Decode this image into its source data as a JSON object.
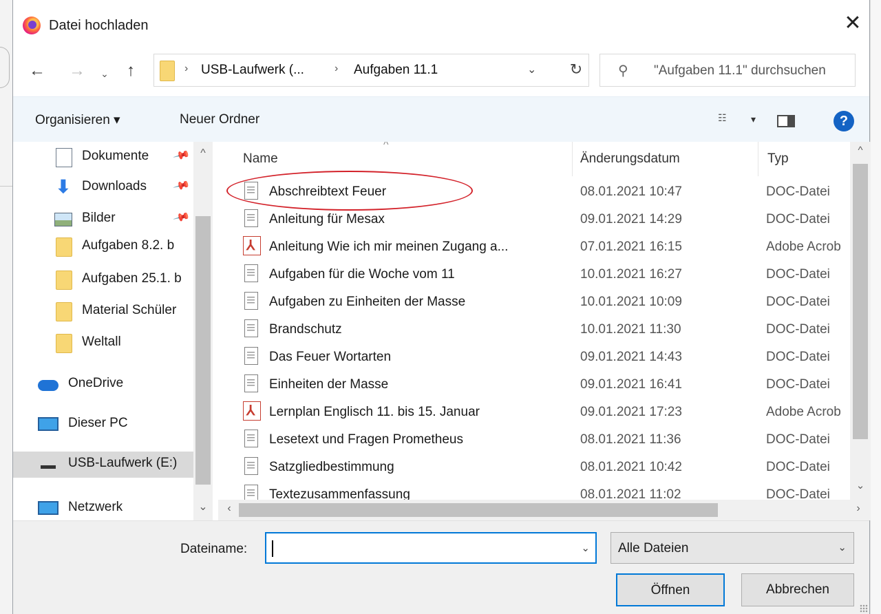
{
  "window": {
    "title": "Datei hochladen",
    "close_icon": "close-icon"
  },
  "nav": {
    "back": "←",
    "forward": "→",
    "recent": "⌄",
    "up": "↑",
    "breadcrumbs": [
      "USB-Laufwerk (...",
      "Aufgaben 11.1"
    ],
    "crumb_sep": "›",
    "dropdown": "⌄",
    "refresh": "↻",
    "search_placeholder": "\"Aufgaben 11.1\" durchsuchen"
  },
  "commandbar": {
    "organize": "Organisieren ▾",
    "new_folder": "Neuer Ordner",
    "view_drop": "▾",
    "help": "?"
  },
  "sidebar": {
    "items": [
      {
        "label": "Dokumente",
        "icon": "documents-icon",
        "pinned": true
      },
      {
        "label": "Downloads",
        "icon": "download-arrow-icon",
        "pinned": true
      },
      {
        "label": "Bilder",
        "icon": "pictures-icon",
        "pinned": true
      },
      {
        "label": "Aufgaben  8.2. b",
        "icon": "folder-icon"
      },
      {
        "label": "Aufgaben 25.1. b",
        "icon": "folder-icon"
      },
      {
        "label": "Material Schüler",
        "icon": "folder-icon"
      },
      {
        "label": "Weltall",
        "icon": "folder-icon"
      },
      {
        "label": "OneDrive",
        "icon": "cloud-icon"
      },
      {
        "label": "Dieser PC",
        "icon": "monitor-icon"
      },
      {
        "label": "USB-Laufwerk (E:)",
        "icon": "usb-drive-icon",
        "selected": true
      },
      {
        "label": "Netzwerk",
        "icon": "network-icon"
      }
    ],
    "pin_glyph": "📌"
  },
  "filelist": {
    "columns": {
      "name": "Name",
      "date": "Änderungsdatum",
      "type": "Typ"
    },
    "sort_caret": "^",
    "rows": [
      {
        "name": "Abschreibtext Feuer",
        "date": "08.01.2021 10:47",
        "type": "DOC-Datei",
        "kind": "doc"
      },
      {
        "name": "Anleitung für Mesax",
        "date": "09.01.2021 14:29",
        "type": "DOC-Datei",
        "kind": "doc"
      },
      {
        "name": "Anleitung Wie ich mir meinen Zugang a...",
        "date": "07.01.2021 16:15",
        "type": "Adobe Acrob",
        "kind": "pdf"
      },
      {
        "name": "Aufgaben für die Woche vom 11",
        "date": "10.01.2021 16:27",
        "type": "DOC-Datei",
        "kind": "doc"
      },
      {
        "name": "Aufgaben zu Einheiten der Masse",
        "date": "10.01.2021 10:09",
        "type": "DOC-Datei",
        "kind": "doc"
      },
      {
        "name": "Brandschutz",
        "date": "10.01.2021 11:30",
        "type": "DOC-Datei",
        "kind": "doc"
      },
      {
        "name": "Das Feuer Wortarten",
        "date": "09.01.2021 14:43",
        "type": "DOC-Datei",
        "kind": "doc"
      },
      {
        "name": "Einheiten der Masse",
        "date": "09.01.2021 16:41",
        "type": "DOC-Datei",
        "kind": "doc"
      },
      {
        "name": "Lernplan Englisch 11. bis 15. Januar",
        "date": "09.01.2021 17:23",
        "type": "Adobe Acrob",
        "kind": "pdf"
      },
      {
        "name": "Lesetext und Fragen Prometheus",
        "date": "08.01.2021 11:36",
        "type": "DOC-Datei",
        "kind": "doc"
      },
      {
        "name": "Satzgliedbestimmung",
        "date": "08.01.2021 10:42",
        "type": "DOC-Datei",
        "kind": "doc"
      },
      {
        "name": "Textezusammenfassung",
        "date": "08.01.2021 11:02",
        "type": "DOC-Datei",
        "kind": "doc"
      }
    ],
    "highlighted_row": "Abschreibtext Feuer",
    "highlight_color": "#d3222a"
  },
  "footer": {
    "filename_label": "Dateiname:",
    "filename_value": "",
    "filetype": "Alle Dateien",
    "open": "Öffnen",
    "cancel": "Abbrechen"
  },
  "colors": {
    "accent": "#0078d7",
    "commandbar_bg": "#f0f6fb",
    "folder": "#f8d775",
    "help": "#1463c4"
  }
}
